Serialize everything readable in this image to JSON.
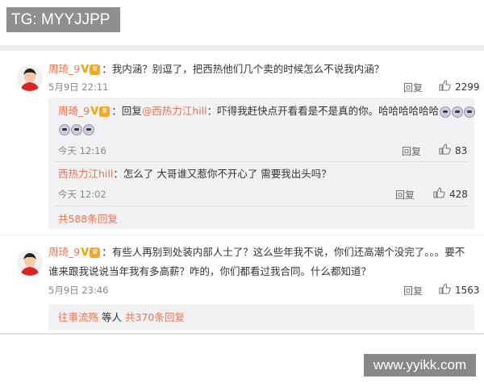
{
  "watermark_top": "TG: MYYJJPP",
  "watermark_bottom": "www.yyikk.com",
  "comments": [
    {
      "username": "周琦_9",
      "text": "：我内涵？别逗了，把西热他们几个卖的时候怎么不说我内涵？",
      "time": "5月9日 22:11",
      "reply_label": "回复",
      "likes": "2299",
      "replies": [
        {
          "username": "周琦_9",
          "reply_prefix": "：回复",
          "mention": "@西热力江hill",
          "text": "：吓得我赶快点开看看是不是真的你。哈哈哈哈哈哈",
          "time": "今天 12:16",
          "reply_label": "回复",
          "likes": "83"
        },
        {
          "username": "西热力江hill",
          "text": "：怎么了 大哥谁又惹你不开心了 需要我出头吗？",
          "time": "今天 12:02",
          "reply_label": "回复",
          "likes": "428"
        }
      ],
      "more_replies": "共588条回复"
    },
    {
      "username": "周琦_9",
      "text_line1": "：有些人再别到处装内部人士了？这么些年我不说，你们还高潮个没完了。。。要不",
      "text_line2": "谁来跟我说说当年我有多高薪？咋的，你们都看过我合同。什么都知道？",
      "time": "5月9日 23:46",
      "reply_label": "回复",
      "likes": "1563",
      "sub_user": "往事流殇",
      "sub_mid": " 等人 ",
      "more_replies": "共370条回复"
    }
  ]
}
